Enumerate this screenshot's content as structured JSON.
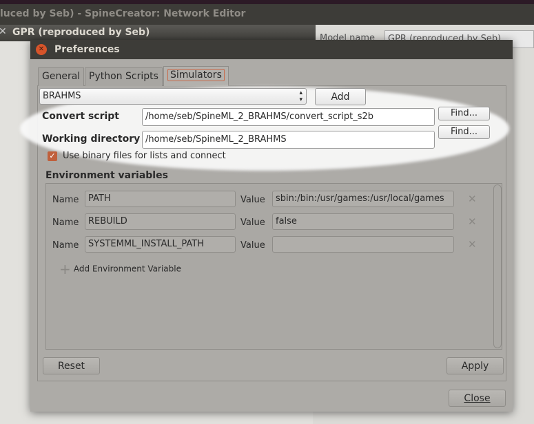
{
  "main_window": {
    "title": "luced by Seb) - SpineCreator: Network Editor"
  },
  "sub_window": {
    "title": "GPR (reproduced by Seb)",
    "model_name_label": "Model name",
    "model_name_value": "GPR (reproduced by Seb)"
  },
  "dialog": {
    "title": "Preferences",
    "tabs": [
      {
        "label": "General"
      },
      {
        "label": "Python Scripts"
      },
      {
        "label": "Simulators",
        "selected": true
      }
    ],
    "simulator_select": "BRAHMS",
    "add_label": "Add",
    "convert_script": {
      "label": "Convert script",
      "value": "/home/seb/SpineML_2_BRAHMS/convert_script_s2b",
      "find": "Find..."
    },
    "working_directory": {
      "label": "Working directory",
      "value": "/home/seb/SpineML_2_BRAHMS",
      "find": "Find..."
    },
    "binary_files": {
      "label": "Use binary files for lists and connect",
      "checked": true
    },
    "env_title": "Environment variables",
    "env_vars": [
      {
        "name_label": "Name",
        "name": "PATH",
        "value_label": "Value",
        "value": "sbin:/bin:/usr/games:/usr/local/games"
      },
      {
        "name_label": "Name",
        "name": "REBUILD",
        "value_label": "Value",
        "value": "false"
      },
      {
        "name_label": "Name",
        "name": "SYSTEMML_INSTALL_PATH",
        "value_label": "Value",
        "value": ""
      }
    ],
    "add_env_label": "Add Environment Variable",
    "reset_label": "Reset",
    "apply_label": "Apply",
    "close_label": "Close"
  },
  "colors": {
    "close_button": "#d7542a",
    "highlight": "#fafafa",
    "tab_selected_border": "#c86a4a"
  }
}
